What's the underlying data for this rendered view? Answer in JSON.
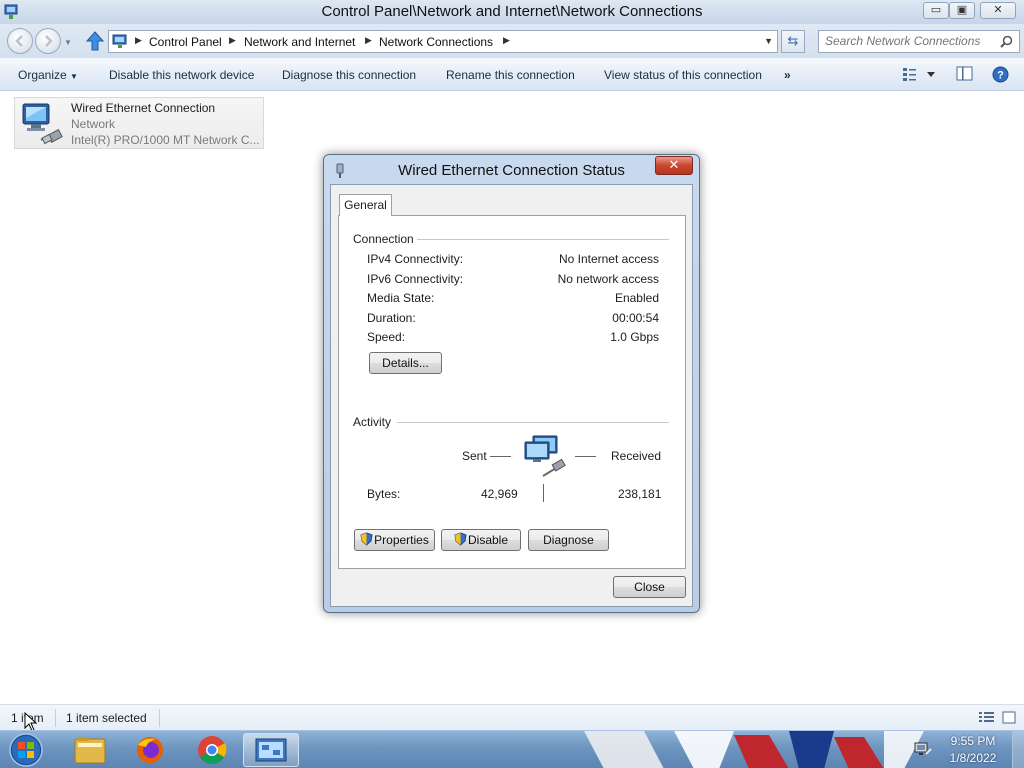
{
  "window": {
    "title": "Control Panel\\Network and Internet\\Network Connections",
    "minimize_label": "▭",
    "maximize_label": "▣",
    "close_label": "✕"
  },
  "address": {
    "crumbs": [
      "Control Panel",
      "Network and Internet",
      "Network Connections"
    ],
    "search_placeholder": "Search Network Connections"
  },
  "toolbar": {
    "organize": "Organize",
    "disable": "Disable this network device",
    "diagnose": "Diagnose this connection",
    "rename": "Rename this connection",
    "view_status": "View status of this connection",
    "more": "»"
  },
  "connection_tile": {
    "name": "Wired Ethernet Connection",
    "network": "Network",
    "adapter": "Intel(R) PRO/1000 MT Network C..."
  },
  "dialog": {
    "title": "Wired Ethernet Connection Status",
    "close_glyph": "✕",
    "tab_general": "General",
    "connection_section": "Connection",
    "rows": [
      {
        "label": "IPv4 Connectivity:",
        "value": "No Internet access"
      },
      {
        "label": "IPv6 Connectivity:",
        "value": "No network access"
      },
      {
        "label": "Media State:",
        "value": "Enabled"
      },
      {
        "label": "Duration:",
        "value": "00:00:54"
      },
      {
        "label": "Speed:",
        "value": "1.0 Gbps"
      }
    ],
    "details_button": "Details...",
    "activity_section": "Activity",
    "sent_label": "Sent",
    "received_label": "Received",
    "bytes_label": "Bytes:",
    "bytes_sent": "42,969",
    "bytes_received": "238,181",
    "properties_button": "Properties",
    "disable_button": "Disable",
    "diagnose_button": "Diagnose",
    "close_button": "Close"
  },
  "status_bar": {
    "item_count": "1 item",
    "selected": "1 item selected"
  },
  "taskbar": {
    "time": "9:55 PM",
    "date": "1/8/2022"
  },
  "icons": [
    "app-icon",
    "back-icon",
    "forward-icon",
    "up-arrow-icon",
    "location-icon",
    "refresh-icon",
    "search-icon",
    "view-options-icon",
    "preview-pane-icon",
    "help-icon",
    "network-adapter-icon",
    "network-computers-icon",
    "uac-shield-icon",
    "windows-start-icon",
    "file-explorer-icon",
    "firefox-icon",
    "chrome-icon",
    "network-connections-icon",
    "network-tray-icon"
  ]
}
